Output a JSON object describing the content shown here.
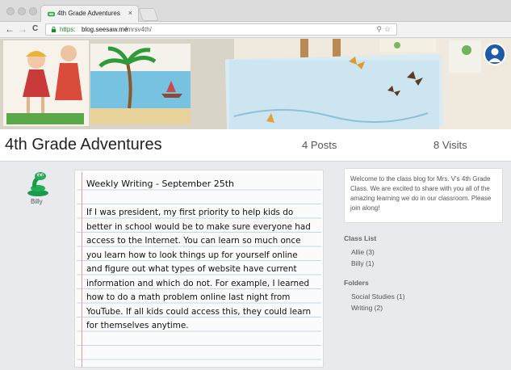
{
  "browser": {
    "tab_title": "4th Grade Adventures",
    "tab_close": "×",
    "url_scheme": "https:",
    "url_host": "blog.seesaw.me",
    "url_path": "/mrsv4th/",
    "nav_back": "←",
    "nav_forward": "→",
    "nav_reload": "C",
    "omni_icons": "⚲☆"
  },
  "header": {
    "title": "4th Grade Adventures",
    "posts": "4 Posts",
    "visits": "8 Visits"
  },
  "post": {
    "author": "Billy",
    "title": "Weekly Writing - September 25th",
    "body": "If I was president, my first priority to help kids do better in school would be to make sure everyone had access to the Internet. You can learn so much once you learn how to look things up for yourself online and figure out what types of website have current information and which do not. For example, I learned how to do a math problem online last night from YouTube. If all kids could access this, they could learn for themselves anytime."
  },
  "sidebar": {
    "about": "Welcome to the class blog for Mrs. V's 4th Grade Class. We are excited to share with you all of the amazing learning we do in our classroom. Please join along!",
    "class_list_title": "Class List",
    "class_list": [
      {
        "label": "Allie (3)"
      },
      {
        "label": "Billy (1)"
      }
    ],
    "folders_title": "Folders",
    "folders": [
      {
        "label": "Social Studies (1)"
      },
      {
        "label": "Writing (2)"
      }
    ]
  },
  "colors": {
    "accent": "#1f5aa8",
    "author_icon": "#1a9a4a",
    "secure_url": "#1a8a2e"
  }
}
